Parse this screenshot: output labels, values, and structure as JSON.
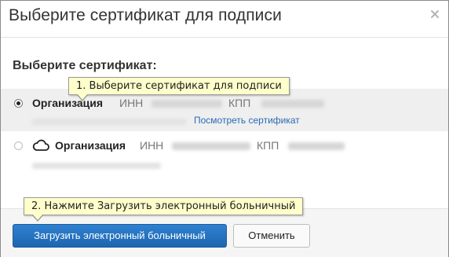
{
  "dialog": {
    "title": "Выберите сертификат для подписи",
    "section_label": "Выберите сертификат:"
  },
  "certificates": [
    {
      "org": "Организация",
      "inn_label": "ИНН",
      "kpp_label": "КПП",
      "view_link": "Посмотреть сертификат",
      "selected": true
    },
    {
      "org": "Организация",
      "inn_label": "ИНН",
      "kpp_label": "КПП",
      "selected": false,
      "icon": "cloud-icon"
    }
  ],
  "tooltips": {
    "step1": "1. Выберите сертификат для подписи",
    "step2": "2. Нажмите Загрузить электронный больничный"
  },
  "buttons": {
    "primary": "Загрузить электронный больничный",
    "cancel": "Отменить"
  },
  "colors": {
    "primary_button": "#2a74c2",
    "link": "#2a6bb5",
    "tooltip_bg": "#ffffcc",
    "selected_row": "#efefef"
  }
}
